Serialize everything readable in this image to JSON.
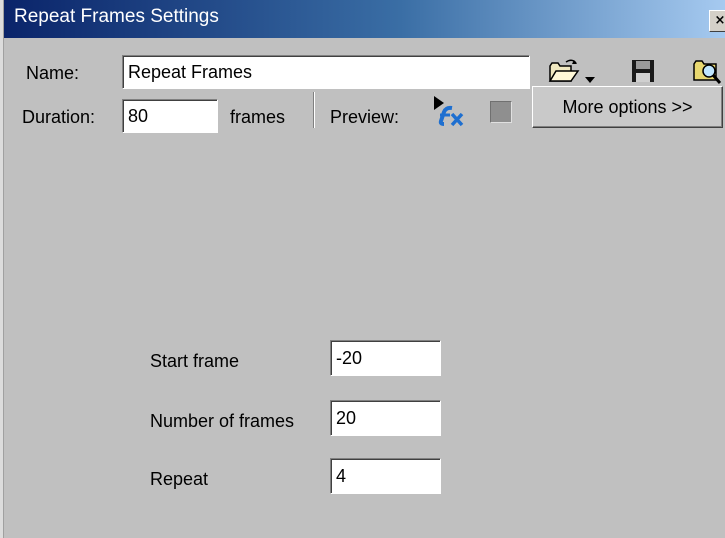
{
  "window": {
    "title": "Repeat Frames Settings",
    "close_glyph": "×"
  },
  "toolbar": {
    "name_label": "Name:",
    "name_value": "Repeat Frames",
    "open_icon": "folder-open-icon",
    "dropdown_icon": "dropdown-arrow-icon",
    "save_icon": "floppy-disk-save-icon",
    "browse_icon": "folder-search-icon"
  },
  "duration": {
    "label": "Duration:",
    "value": "80",
    "unit": "frames",
    "preview_label": "Preview:",
    "preview_icon": "fx-play-icon",
    "stop_icon": "stop-icon",
    "more_options": "More options >>"
  },
  "params": [
    {
      "label": "Start frame",
      "value": "-20"
    },
    {
      "label": "Number of frames",
      "value": "20"
    },
    {
      "label": "Repeat",
      "value": "4"
    }
  ],
  "colors": {
    "face": "#c0c0c0",
    "title_start": "#0a246a",
    "title_end": "#a6caf0",
    "fx_blue": "#1e6fd0"
  }
}
